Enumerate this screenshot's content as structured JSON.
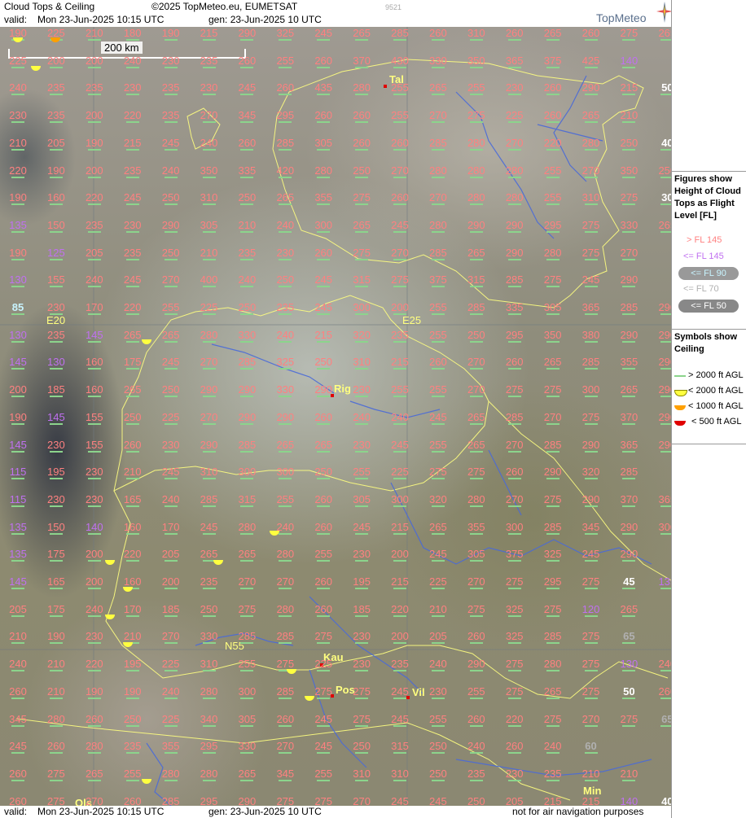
{
  "header": {
    "title": "Cloud Tops & Ceiling",
    "copyright": "©2025 TopMeteo.eu, EUMETSAT",
    "code": "9521",
    "valid_label": "valid:",
    "valid_value": "Mon  23-Jun-2025  10:15 UTC",
    "gen_label": "gen: 23-Jun-2025 10 UTC",
    "logo": "TopMeteo"
  },
  "footer": {
    "valid_label": "valid:",
    "valid_value": "Mon  23-Jun-2025  10:15 UTC",
    "gen_label": "gen: 23-Jun-2025 10 UTC",
    "notice": "not for air navigation purposes"
  },
  "scale": {
    "label": "200 km"
  },
  "legend": {
    "tops_title": "Figures show Height of Cloud Tops as Flight Level  [FL]",
    "tops": [
      {
        "label": "> FL 145",
        "color": "#ff8080"
      },
      {
        "label": "<= FL 145",
        "color": "#c070f0"
      },
      {
        "label": "<= FL 90",
        "color": "#c8f4ff"
      },
      {
        "label": "<= FL 70",
        "color": "#b0b0b0"
      },
      {
        "label": "<= FL 50",
        "color": "#ffffff"
      }
    ],
    "ceiling_title": "Symbols show Ceiling",
    "ceiling": [
      {
        "label": "> 2000 ft AGL",
        "color": "#8cd48c"
      },
      {
        "label": "< 2000 ft AGL",
        "color": "#ffff40"
      },
      {
        "label": "< 1000 ft AGL",
        "color": "#ffa000"
      },
      {
        "label": "< 500 ft AGL",
        "color": "#e00000"
      }
    ]
  },
  "map": {
    "grid_labels": [
      "E20",
      "E25",
      "N55"
    ],
    "cities": [
      "Tal",
      "Rig",
      "Kau",
      "Pos",
      "Vil",
      "Min",
      "Ols"
    ],
    "rows": [
      [
        "190",
        "225",
        "210",
        "180",
        "190",
        "215",
        "290",
        "325",
        "245",
        "265",
        "285",
        "260",
        "310",
        "260",
        "265",
        "260",
        "275",
        "265"
      ],
      [
        "225",
        "200",
        "200",
        "240",
        "230",
        "235",
        "260",
        "255",
        "260",
        "370",
        "430",
        "330",
        "350",
        "365",
        "375",
        "425",
        "140"
      ],
      [
        "240",
        "235",
        "235",
        "230",
        "235",
        "230",
        "245",
        "260",
        "435",
        "280",
        "255",
        "265",
        "255",
        "230",
        "260",
        "290",
        "215",
        "50"
      ],
      [
        "230",
        "235",
        "200",
        "220",
        "235",
        "270",
        "345",
        "295",
        "260",
        "260",
        "255",
        "270",
        "275",
        "225",
        "260",
        "265",
        "210"
      ],
      [
        "210",
        "205",
        "190",
        "215",
        "245",
        "240",
        "260",
        "285",
        "305",
        "260",
        "260",
        "285",
        "280",
        "270",
        "220",
        "280",
        "250",
        "40"
      ],
      [
        "220",
        "190",
        "200",
        "235",
        "240",
        "350",
        "335",
        "420",
        "280",
        "250",
        "270",
        "280",
        "280",
        "280",
        "255",
        "270",
        "350",
        "250",
        "30"
      ],
      [
        "190",
        "160",
        "220",
        "245",
        "250",
        "310",
        "250",
        "265",
        "355",
        "275",
        "260",
        "270",
        "280",
        "280",
        "255",
        "310",
        "275",
        "30"
      ],
      [
        "135",
        "150",
        "235",
        "230",
        "290",
        "305",
        "210",
        "240",
        "300",
        "265",
        "245",
        "280",
        "290",
        "290",
        "295",
        "275",
        "330",
        "265"
      ],
      [
        "190",
        "125",
        "205",
        "235",
        "250",
        "210",
        "235",
        "230",
        "260",
        "275",
        "270",
        "285",
        "265",
        "290",
        "280",
        "275",
        "270"
      ],
      [
        "130",
        "155",
        "240",
        "245",
        "270",
        "400",
        "240",
        "250",
        "245",
        "315",
        "275",
        "375",
        "315",
        "285",
        "275",
        "245",
        "290"
      ],
      [
        "85",
        "230",
        "170",
        "220",
        "255",
        "225",
        "250",
        "235",
        "245",
        "300",
        "200",
        "255",
        "285",
        "335",
        "305",
        "365",
        "285",
        "290"
      ],
      [
        "130",
        "235",
        "145",
        "265",
        "265",
        "280",
        "330",
        "240",
        "215",
        "320",
        "235",
        "255",
        "250",
        "295",
        "350",
        "380",
        "290",
        "290"
      ],
      [
        "145",
        "130",
        "160",
        "175",
        "245",
        "270",
        "285",
        "325",
        "250",
        "310",
        "215",
        "260",
        "270",
        "260",
        "265",
        "285",
        "355",
        "290"
      ],
      [
        "200",
        "185",
        "160",
        "265",
        "250",
        "290",
        "290",
        "330",
        "290",
        "230",
        "255",
        "255",
        "270",
        "275",
        "275",
        "300",
        "265",
        "290"
      ],
      [
        "190",
        "145",
        "155",
        "250",
        "225",
        "270",
        "290",
        "290",
        "260",
        "240",
        "240",
        "245",
        "265",
        "285",
        "270",
        "275",
        "370",
        "290"
      ],
      [
        "145",
        "230",
        "155",
        "260",
        "230",
        "290",
        "285",
        "265",
        "265",
        "230",
        "245",
        "255",
        "265",
        "270",
        "285",
        "290",
        "365",
        "290"
      ],
      [
        "115",
        "195",
        "230",
        "210",
        "245",
        "310",
        "300",
        "300",
        "250",
        "255",
        "225",
        "275",
        "275",
        "260",
        "290",
        "320",
        "285"
      ],
      [
        "115",
        "230",
        "230",
        "165",
        "240",
        "285",
        "315",
        "255",
        "260",
        "305",
        "300",
        "320",
        "280",
        "270",
        "275",
        "290",
        "370",
        "365"
      ],
      [
        "135",
        "150",
        "140",
        "160",
        "170",
        "245",
        "280",
        "240",
        "260",
        "245",
        "215",
        "265",
        "355",
        "300",
        "285",
        "345",
        "290",
        "300"
      ],
      [
        "135",
        "175",
        "200",
        "220",
        "205",
        "265",
        "265",
        "280",
        "255",
        "230",
        "200",
        "245",
        "305",
        "375",
        "325",
        "245",
        "290"
      ],
      [
        "145",
        "165",
        "200",
        "160",
        "200",
        "235",
        "270",
        "270",
        "260",
        "195",
        "215",
        "225",
        "270",
        "275",
        "295",
        "275",
        "45",
        "135"
      ],
      [
        "205",
        "175",
        "240",
        "170",
        "185",
        "250",
        "275",
        "280",
        "260",
        "185",
        "220",
        "210",
        "275",
        "325",
        "275",
        "120",
        "265"
      ],
      [
        "210",
        "190",
        "230",
        "210",
        "270",
        "330",
        "285",
        "285",
        "275",
        "230",
        "200",
        "205",
        "260",
        "325",
        "285",
        "275",
        "65"
      ],
      [
        "240",
        "210",
        "220",
        "195",
        "225",
        "310",
        "255",
        "275",
        "225",
        "230",
        "235",
        "240",
        "290",
        "275",
        "280",
        "275",
        "130",
        "240"
      ],
      [
        "260",
        "210",
        "190",
        "190",
        "240",
        "280",
        "300",
        "285",
        "275",
        "275",
        "245",
        "230",
        "255",
        "275",
        "265",
        "275",
        "50",
        "260"
      ],
      [
        "345",
        "280",
        "260",
        "250",
        "225",
        "340",
        "305",
        "260",
        "245",
        "275",
        "245",
        "255",
        "260",
        "220",
        "275",
        "270",
        "275",
        "65",
        "120"
      ],
      [
        "245",
        "260",
        "280",
        "235",
        "355",
        "295",
        "330",
        "270",
        "245",
        "250",
        "315",
        "250",
        "240",
        "260",
        "240",
        "60"
      ],
      [
        "260",
        "275",
        "265",
        "255",
        "280",
        "280",
        "265",
        "345",
        "255",
        "310",
        "310",
        "250",
        "235",
        "230",
        "235",
        "210",
        "210"
      ],
      [
        "260",
        "275",
        "270",
        "260",
        "285",
        "295",
        "290",
        "275",
        "275",
        "270",
        "245",
        "245",
        "250",
        "205",
        "215",
        "215",
        "140",
        "40"
      ]
    ]
  }
}
